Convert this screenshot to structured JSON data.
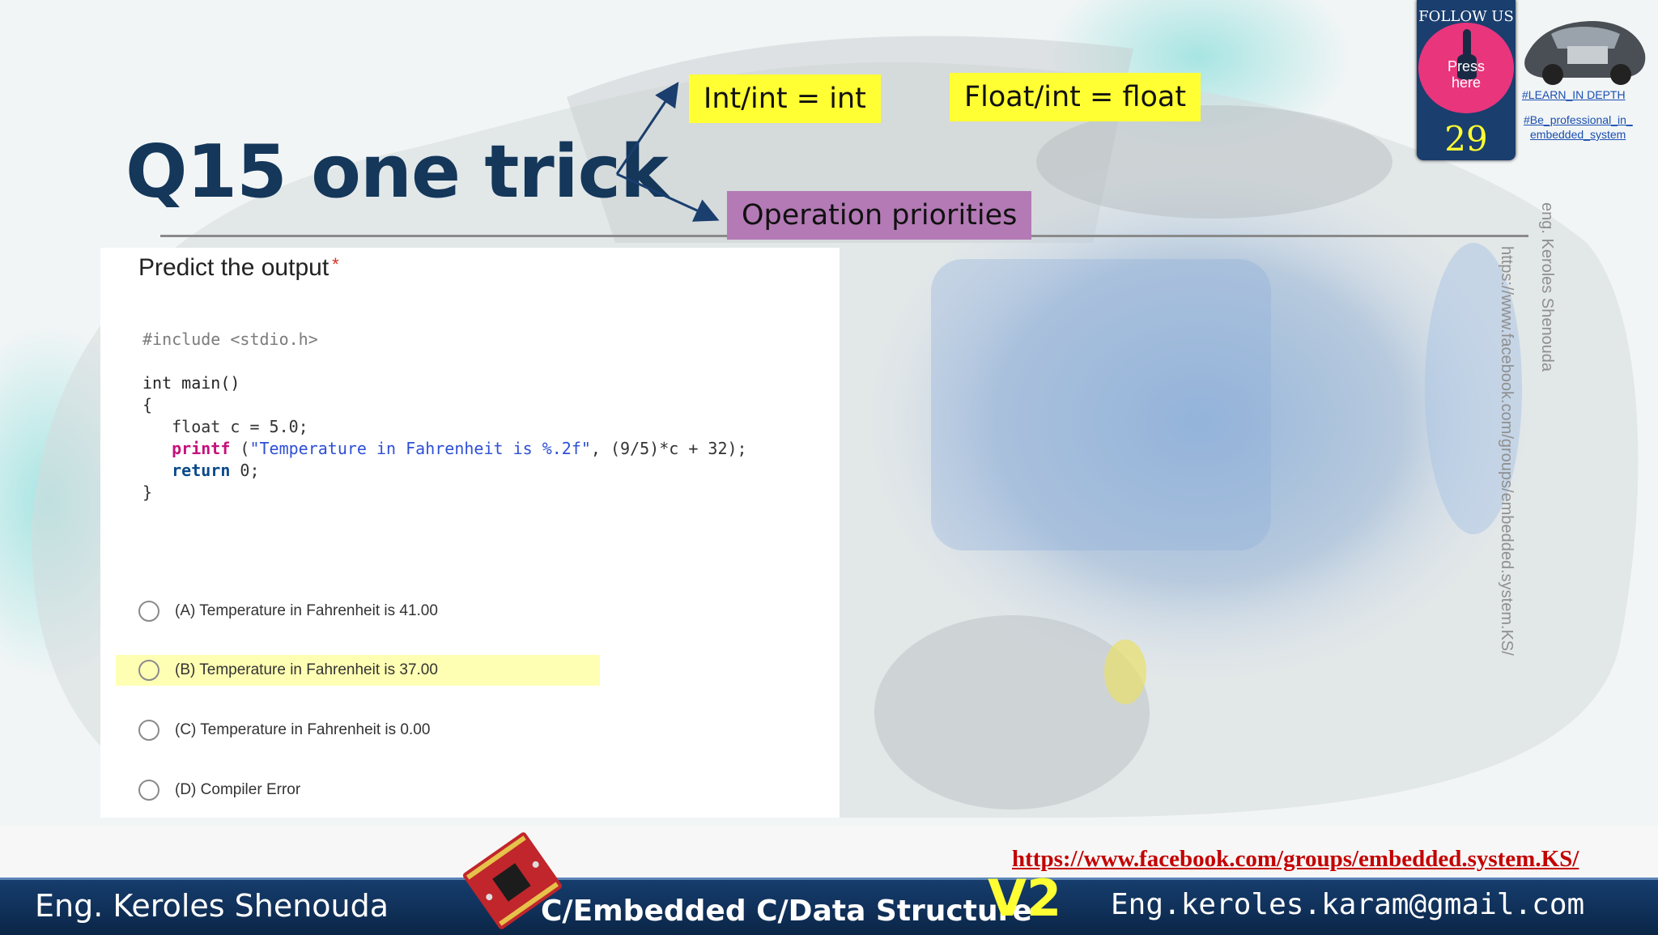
{
  "slide": {
    "title": "Q15 one trick",
    "notes": {
      "int_div": "Int/int = int",
      "float_div": "Float/int = float",
      "priorities": "Operation priorities"
    }
  },
  "quiz": {
    "question": "Predict the output",
    "required_mark": "*",
    "code": {
      "line1": "#include <stdio.h>",
      "line2": "int main()",
      "line3": "{",
      "line4": "   float c = 5.0;",
      "line5_fn": "printf",
      "line5_open": " (",
      "line5_str": "\"Temperature in Fahrenheit is %.2f\"",
      "line5_rest": ", (9/5)*c + 32);",
      "line6_kw": "return",
      "line6_rest": " 0;",
      "line7": "}"
    },
    "options": [
      {
        "label": "(A) Temperature in Fahrenheit is 41.00"
      },
      {
        "label": "(B) Temperature in Fahrenheit is 37.00"
      },
      {
        "label": "(C) Temperature in Fahrenheit is 0.00"
      },
      {
        "label": "(D) Compiler Error"
      }
    ],
    "highlighted_option": "B"
  },
  "follow": {
    "title": "FOLLOW US",
    "press": "Press here",
    "count": "29",
    "tag1": "#LEARN_IN DEPTH",
    "tag2a": "#Be_professional_in_",
    "tag2b": "embedded_system"
  },
  "side_text": {
    "author": "eng. Keroles Shenouda",
    "url": "https://www.facebook.com/groups/embedded.system.KS/"
  },
  "footer": {
    "link": "https://www.facebook.com/groups/embedded.system.KS/",
    "author": "Eng. Keroles Shenouda",
    "course": "C/Embedded C/Data Structure",
    "version": "V2",
    "email": "Eng.keroles.karam@gmail.com"
  },
  "colors": {
    "title": "#14375a",
    "note_yellow": "#ffff33",
    "note_purple": "#b37ab5",
    "footer_bg": "#163d6d",
    "link_red": "#c40000",
    "highlight": "#ffffb4"
  }
}
